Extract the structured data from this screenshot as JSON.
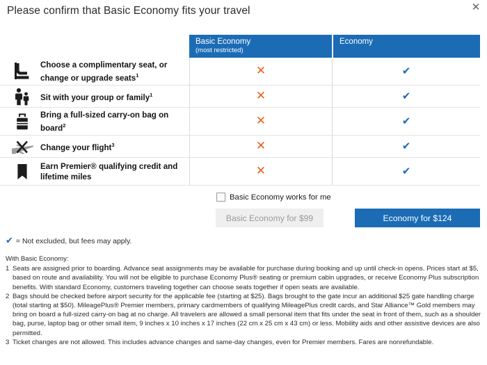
{
  "dialog": {
    "title": "Please confirm that Basic Economy fits your travel",
    "close_icon": "close-icon"
  },
  "colors": {
    "brand_blue": "#1b6cb5",
    "x_orange": "#e8601c",
    "check_blue": "#1b6cb5",
    "disabled_bg": "#efefef",
    "disabled_text": "#9a9a9a"
  },
  "table": {
    "columns": [
      {
        "title": "Basic Economy",
        "subtitle": "(most restricted)"
      },
      {
        "title": "Economy",
        "subtitle": ""
      }
    ],
    "rows": [
      {
        "icon": "airline-seat-icon",
        "label": "Choose a complimentary seat, or change or upgrade seats",
        "footnote": "1",
        "basic_economy": "✕",
        "economy": "✔"
      },
      {
        "icon": "family-group-icon",
        "label": "Sit with your group or family",
        "footnote": "1",
        "basic_economy": "✕",
        "economy": "✔"
      },
      {
        "icon": "carry-on-bag-icon",
        "label": "Bring a full-sized carry-on bag on board",
        "footnote": "2",
        "basic_economy": "✕",
        "economy": "✔"
      },
      {
        "icon": "change-flight-icon",
        "label": "Change your flight",
        "footnote": "3",
        "basic_economy": "✕",
        "economy": "✔"
      },
      {
        "icon": "premier-bookmark-icon",
        "label": "Earn Premier® qualifying credit and lifetime miles",
        "footnote": "",
        "basic_economy": "✕",
        "economy": "✔"
      }
    ]
  },
  "confirm": {
    "checkbox_label": "Basic Economy works for me",
    "checkbox_checked": false,
    "basic_button_label": "Basic Economy for $99",
    "economy_button_label": "Economy for $124"
  },
  "legend": {
    "check_glyph": "✔",
    "text": "= Not excluded, but fees may apply."
  },
  "footnotes": {
    "heading": "With Basic Economy:",
    "items": [
      {
        "num": "1",
        "text": "Seats are assigned prior to boarding. Advance seat assignments may be available for purchase during booking and up until check-in opens. Prices start at $5, based on route and availability. You will not be eligible to purchase Economy Plus® seating or premium cabin upgrades, or receive Economy Plus subscription benefits. With standard Economy, customers traveling together can choose seats together if open seats are available."
      },
      {
        "num": "2",
        "text": "Bags should be checked before airport security for the applicable fee (starting at $25). Bags brought to the gate incur an additional $25 gate handling charge (total starting at $50). MileagePlus® Premier members, primary cardmembers of qualifying MileagePlus credit cards, and Star Alliance™ Gold members may bring on board a full-sized carry-on bag at no charge. All travelers are allowed a small personal item that fits under the seat in front of them, such as a shoulder bag, purse, laptop bag or other small item, 9 inches x 10 inches x 17 inches (22 cm x 25 cm x 43 cm) or less. Mobility aids and other assistive devices are also permitted."
      },
      {
        "num": "3",
        "text": "Ticket changes are not allowed. This includes advance changes and same-day changes, even for Premier members. Fares are nonrefundable."
      }
    ]
  }
}
